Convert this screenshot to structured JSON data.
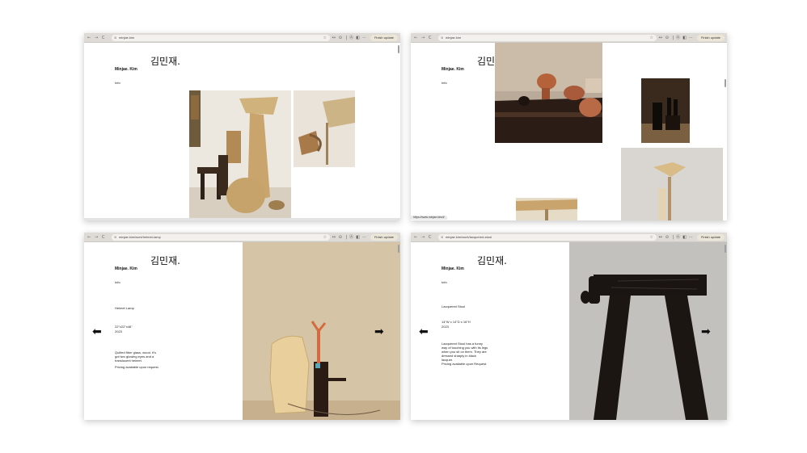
{
  "browser": {
    "back_icon": "←",
    "forward_icon": "→",
    "reload_icon": "C",
    "star_icon": "☆",
    "ext_icons": [
      "↔",
      "⊙",
      "|",
      "Ⓐ",
      "◧",
      "⋯"
    ],
    "finish_update": "Finish update"
  },
  "site": {
    "logo": "김민재.",
    "name": "Minjae. Kim",
    "info": "Info"
  },
  "windows": [
    {
      "url": "minjae.kim"
    },
    {
      "url": "minjae.kim",
      "status_url": "https://www.minjae.kim/#"
    },
    {
      "url": "minjae.kim/work/helmet-lamp",
      "title": "Helmet Lamp",
      "dimensions": "22\"x22\"x46\"",
      "year": "2023",
      "desc": [
        "Quilted fiber glass, wood. It's",
        "got two glowing eyes and a",
        "translucent helmet."
      ],
      "pricing": "Pricing available upon request."
    },
    {
      "url": "minjae.kim/work/lacquered-stool",
      "title": "Lacquered Stool",
      "dimensions": "14\"W x 14\"D x 16\"H",
      "year": "2023",
      "desc": [
        "Lacquered Stool has a funny",
        "way of touching you with its legs",
        "when you sit on them. They are",
        "dressed sharply in black",
        "lacquer."
      ],
      "pricing": "Pricing available upon Request."
    }
  ],
  "nav_arrows": {
    "prev": "⬅",
    "next": "➡"
  }
}
